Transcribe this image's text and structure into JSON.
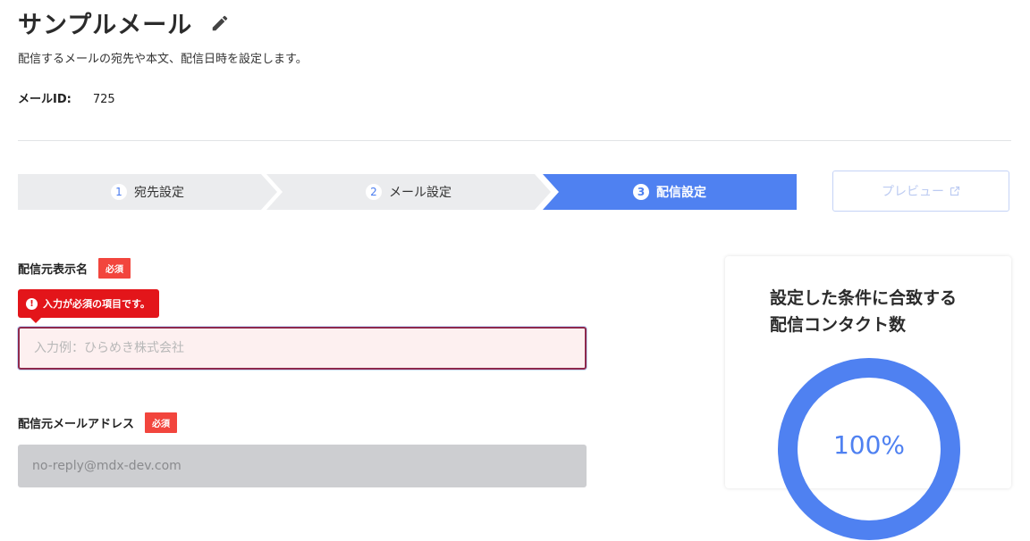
{
  "header": {
    "title": "サンプルメール",
    "description": "配信するメールの宛先や本文、配信日時を設定します。",
    "mail_id_label": "メールID:",
    "mail_id_value": "725"
  },
  "steps": [
    {
      "num": "1",
      "label": "宛先設定",
      "active": false
    },
    {
      "num": "2",
      "label": "メール設定",
      "active": false
    },
    {
      "num": "3",
      "label": "配信設定",
      "active": true
    }
  ],
  "preview_button": {
    "label": "プレビュー",
    "icon": "external-link-icon"
  },
  "form": {
    "sender_name": {
      "label": "配信元表示名",
      "required_badge": "必須",
      "error": "入力が必須の項目です。",
      "placeholder": "入力例：ひらめき株式会社",
      "value": ""
    },
    "sender_email": {
      "label": "配信元メールアドレス",
      "required_badge": "必須",
      "value": "no-reply@mdx-dev.com"
    }
  },
  "contacts_card": {
    "title_line1": "設定した条件に合致する",
    "title_line2": "配信コンタクト数",
    "percent_text": "100%",
    "percent": 100
  },
  "colors": {
    "accent": "#4f81f1",
    "required": "#f2453d",
    "error": "#e3151a"
  }
}
